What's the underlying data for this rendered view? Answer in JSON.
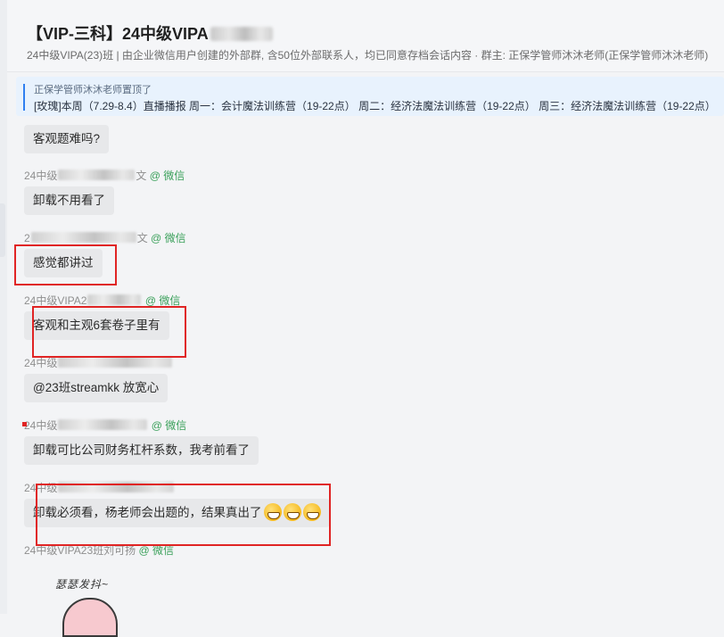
{
  "header": {
    "title": "【VIP-三科】24中级VIPA",
    "subtitle": "24中级VIPA(23)班 | 由企业微信用户创建的外部群, 含50位外部联系人，均已同意存档会话内容 · 群主: 正保学管师沐沐老师(正保学管师沐沐老师)"
  },
  "pinned": {
    "by": "正保学管师沐沐老师置顶了",
    "content": "[玫瑰]本周（7.29-8.4）直播播报 周一：会计魔法训练营（19-22点） 周二：经济法魔法训练营（19-22点）  周三：经济法魔法训练营（19-22点）"
  },
  "source_label": "@ 微信",
  "messages": [
    {
      "sender": "",
      "text": "客观题难吗?"
    },
    {
      "sender": "24中级",
      "sender_suffix": "文",
      "text": "卸载不用看了"
    },
    {
      "sender": "2",
      "sender_suffix": "文",
      "text": "感觉都讲过"
    },
    {
      "sender": "24中级VIPA2",
      "sender_suffix": "",
      "text": "客观和主观6套卷子里有"
    },
    {
      "sender": "24中级",
      "sender_suffix": "",
      "text": "@23班streamkk 放宽心"
    },
    {
      "sender": "24中级",
      "sender_suffix": "",
      "text": "卸载可比公司财务杠杆系数，我考前看了"
    },
    {
      "sender": "24中级",
      "sender_suffix": "",
      "text": "卸载必须看，杨老师会出题的，结果真出了"
    },
    {
      "sender": "24中级VIPA23班刘可扬",
      "sender_suffix": "",
      "text": ""
    }
  ],
  "sticker": {
    "text": "瑟瑟发抖~"
  },
  "icons": {
    "grin": "grinning-emoji"
  },
  "colors": {
    "accent": "#2f7ff0",
    "highlight": "#e02424",
    "wechat": "#3aa05a"
  }
}
